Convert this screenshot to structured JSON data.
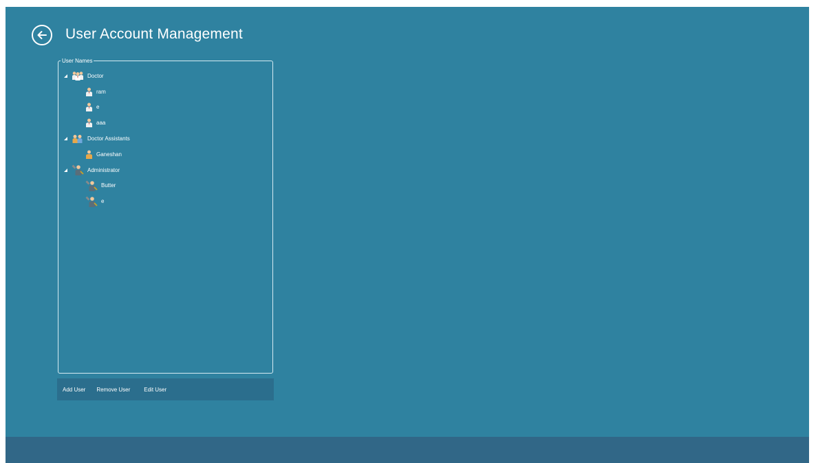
{
  "header": {
    "title": "User Account Management"
  },
  "user_list": {
    "legend": "User Names",
    "groups": [
      {
        "label": "Doctor",
        "icon": "group-icon",
        "users": [
          {
            "label": "ram"
          },
          {
            "label": "e"
          },
          {
            "label": "aaa"
          }
        ]
      },
      {
        "label": "Doctor Assistants",
        "icon": "assistants-icon",
        "users": [
          {
            "label": "Ganeshan"
          }
        ]
      },
      {
        "label": "Administrator",
        "icon": "administrator-icon",
        "users": [
          {
            "label": "Butter"
          },
          {
            "label": "e"
          }
        ]
      }
    ]
  },
  "toolbar": {
    "add_label": "Add User",
    "remove_label": "Remove User",
    "edit_label": "Edit User"
  },
  "colors": {
    "background": "#2f82a0",
    "toolbar": "#2b6e8d",
    "bottom_bar": "#316787",
    "text": "#ffffff"
  }
}
